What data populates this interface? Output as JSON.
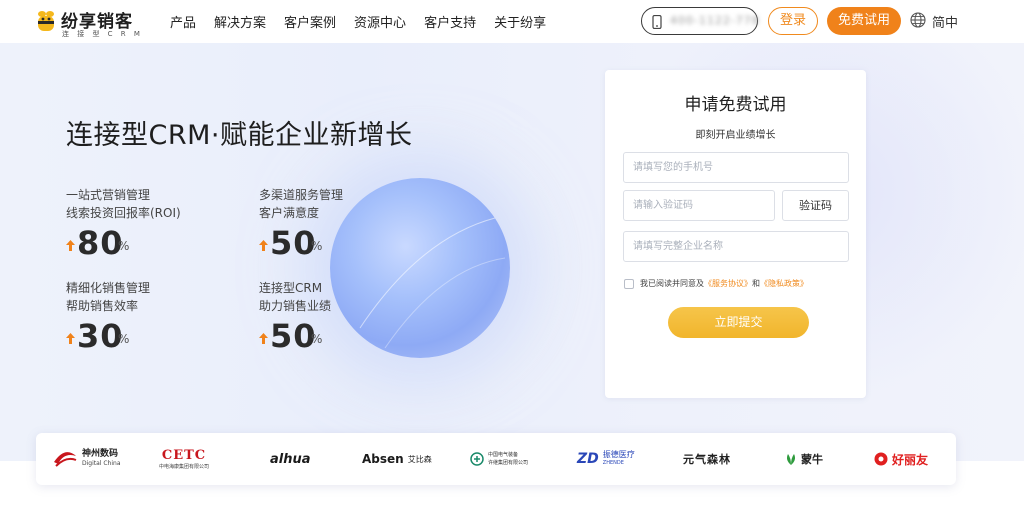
{
  "brand": {
    "name": "纷享销客",
    "tagline": "连 接 型 C R M"
  },
  "nav": {
    "items": [
      "产品",
      "解决方案",
      "客户案例",
      "资源中心",
      "客户支持",
      "关于纷享"
    ]
  },
  "header": {
    "phone_blurred": "400-1122-778",
    "login_label": "登录",
    "trial_label": "免费试用",
    "lang_label": "简中"
  },
  "hero": {
    "title": "连接型CRM·赋能企业新增长",
    "stats": [
      {
        "line1": "一站式营销管理",
        "line2": "线索投资回报率(ROI)",
        "value": "80",
        "unit": "%"
      },
      {
        "line1": "多渠道服务管理",
        "line2": "客户满意度",
        "value": "50",
        "unit": "%"
      },
      {
        "line1": "精细化销售管理",
        "line2": "帮助销售效率",
        "value": "30",
        "unit": "%"
      },
      {
        "line1": "连接型CRM",
        "line2": "助力销售业绩",
        "value": "50",
        "unit": "%"
      }
    ]
  },
  "form": {
    "title": "申请免费试用",
    "subtitle": "即刻开启业绩增长",
    "phone_placeholder": "请填写您的手机号",
    "code_placeholder": "请输入验证码",
    "code_button": "验证码",
    "company_placeholder": "请填写完整企业名称",
    "agree_prefix": "我已阅读并同意及",
    "agree_link1": "《服务协议》",
    "agree_and": "和",
    "agree_link2": "《隐私政策》",
    "submit_label": "立即提交"
  },
  "partners": [
    {
      "name": "神州数码",
      "sub": "Digital China"
    },
    {
      "name": "CETC",
      "sub": "中电海康集团有限公司"
    },
    {
      "name": "alhua",
      "sub": ""
    },
    {
      "name": "Absen",
      "sub": "艾比森"
    },
    {
      "name": "中国电气装备",
      "sub": "许继集团有限公司"
    },
    {
      "name": "振德医疗",
      "sub": "ZHENDE"
    },
    {
      "name": "元气森林",
      "sub": ""
    },
    {
      "name": "蒙牛",
      "sub": ""
    },
    {
      "name": "好丽友",
      "sub": ""
    }
  ],
  "colors": {
    "accent_orange": "#f0821a",
    "submit_yellow": "#f1b52c",
    "hero_bg": "#eef2fb"
  }
}
